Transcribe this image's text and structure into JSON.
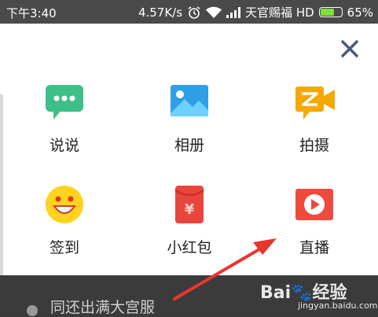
{
  "status_bar": {
    "time": "下午3:40",
    "speed": "4.57K/s",
    "carrier": "天官赐福 HD",
    "battery": "65%",
    "battery_level": 0.65
  },
  "menu": {
    "items": [
      {
        "label": "说说",
        "icon": "chat-bubble-icon",
        "color": "#3dbf8a"
      },
      {
        "label": "相册",
        "icon": "photo-album-icon",
        "color": "#2f9fe6"
      },
      {
        "label": "拍摄",
        "icon": "video-camera-icon",
        "color": "#f6a800"
      },
      {
        "label": "签到",
        "icon": "smiley-icon",
        "color": "#ffd21f"
      },
      {
        "label": "小红包",
        "icon": "red-envelope-icon",
        "color": "#e8453c"
      },
      {
        "label": "直播",
        "icon": "live-play-icon",
        "color": "#ee4b3e"
      }
    ]
  },
  "background_list": {
    "text": "同还出满大宫服"
  },
  "watermark": {
    "brand": "Bai🐾经验",
    "url": "jingyan.baidu.com"
  },
  "colors": {
    "close": "#4a5a7a",
    "annotation_arrow": "#e8362d"
  }
}
